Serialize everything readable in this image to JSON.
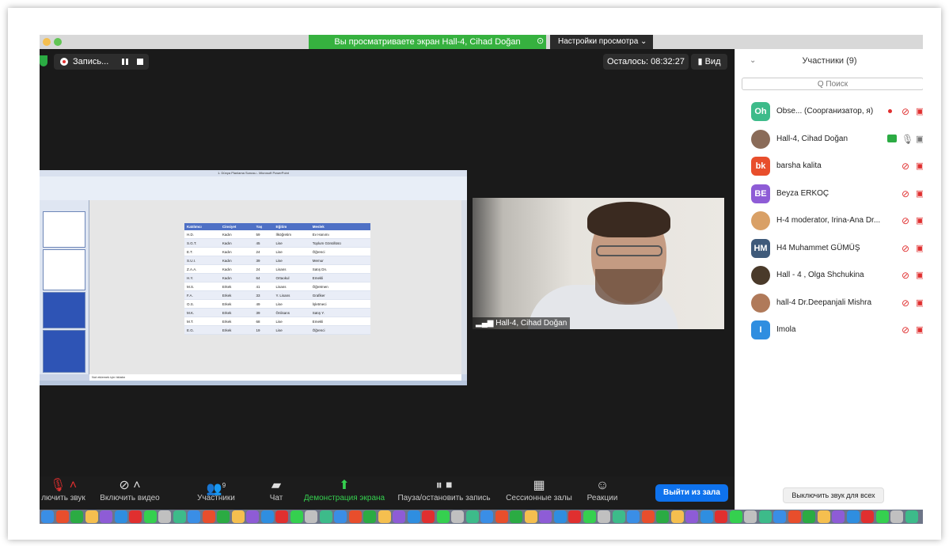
{
  "banner": {
    "sharing_text": "Вы просматриваете экран Hall-4, Cihad Doğan",
    "view_options": "Настройки просмотра ⌄"
  },
  "meeting": {
    "record_label": "Запись...",
    "time_left": "Осталось: 08:32:27",
    "view_label": "Вид"
  },
  "shared_screen": {
    "window_title": "1. Dünya Planlama Sunusu - Microsoft PowerPoint",
    "notes_placeholder": "Not eklemek için tıklatın",
    "table_headers": [
      "Katılımcı",
      "Cinsiyet",
      "Yaş",
      "Eğitim",
      "Meslek"
    ],
    "table_rows": [
      [
        "H.D.",
        "Kadın",
        "59",
        "İlköğretim",
        "Ev Hanımı"
      ],
      [
        "S.G.T.",
        "Kadın",
        "45",
        "Lise",
        "Toplum Gönüllüsü"
      ],
      [
        "E.T.",
        "Kadın",
        "24",
        "Lise",
        "Öğrenci"
      ],
      [
        "S.U.I.",
        "Kadın",
        "39",
        "Lise",
        "Memur"
      ],
      [
        "Z.A.A.",
        "Kadın",
        "24",
        "Lisans",
        "Satış Dn."
      ],
      [
        "H.Y.",
        "Kadın",
        "64",
        "Ortaokul",
        "Emekli"
      ],
      [
        "M.S.",
        "Erkek",
        "41",
        "Lisans",
        "Öğretmen"
      ],
      [
        "F.A.",
        "Erkek",
        "33",
        "Y. Lisans",
        "Grafiker"
      ],
      [
        "O.S.",
        "Erkek",
        "49",
        "Lise",
        "İşletmeci"
      ],
      [
        "M.K.",
        "Erkek",
        "39",
        "Önlisans",
        "Satış Y."
      ],
      [
        "M.T.",
        "Erkek",
        "68",
        "Lise",
        "Emekli"
      ],
      [
        "E.G.",
        "Erkek",
        "19",
        "Lise",
        "Öğrenci"
      ]
    ]
  },
  "video": {
    "name": "Hall-4, Cihad Doğan"
  },
  "toolbar": {
    "mute": "лючить звук",
    "video": "Включить видео",
    "participants": "Участники",
    "participants_count": "9",
    "chat": "Чат",
    "share": "Демонстрация экрана",
    "pause_record": "Пауза/остановить запись",
    "breakout": "Сессионные залы",
    "reactions": "Реакции",
    "leave": "Выйти из зала"
  },
  "panel": {
    "title": "Участники (9)",
    "search_placeholder": "Q Поиск",
    "mute_all": "Выключить звук для всех",
    "participants": [
      {
        "initials": "Oh",
        "name": "Obse... (Соорганизатор, я)",
        "color": "#3dbb8a"
      },
      {
        "initials": "",
        "name": "Hall-4, Cihad Doğan",
        "color": "#8a6b58"
      },
      {
        "initials": "bk",
        "name": "barsha kalita",
        "color": "#e84e2c"
      },
      {
        "initials": "BE",
        "name": "Beyza ERKOÇ",
        "color": "#8e5cd6"
      },
      {
        "initials": "",
        "name": "H-4 moderator, Irina-Ana Dr...",
        "color": "#d9a066"
      },
      {
        "initials": "HM",
        "name": "H4 Muhammet GÜMÜŞ",
        "color": "#3f5a7a"
      },
      {
        "initials": "",
        "name": "Hall - 4 ,  Olga Shchukina",
        "color": "#4a3a2a"
      },
      {
        "initials": "",
        "name": "hall-4 Dr.Deepanjali Mishra",
        "color": "#b07a5a"
      },
      {
        "initials": "I",
        "name": "Imola",
        "color": "#2f8ee0"
      }
    ]
  }
}
